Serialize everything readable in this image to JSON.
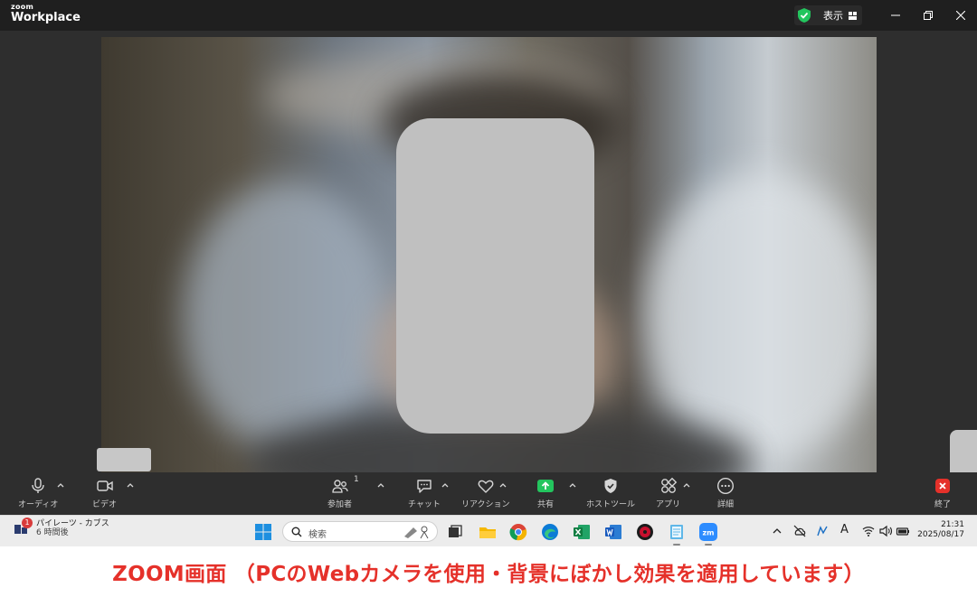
{
  "titlebar": {
    "logo_small": "zoom",
    "logo_big": "Workplace",
    "view_label": "表示"
  },
  "toolbar": {
    "audio_label": "オーディオ",
    "video_label": "ビデオ",
    "participants_label": "参加者",
    "participants_count": "1",
    "chat_label": "チャット",
    "reactions_label": "リアクション",
    "share_label": "共有",
    "host_tools_label": "ホストツール",
    "apps_label": "アプリ",
    "more_label": "詳細",
    "end_label": "終了"
  },
  "taskbar": {
    "news_title": "パイレーツ - カブス",
    "news_sub": "6 時間後",
    "news_badge": "1",
    "search_placeholder": "検索",
    "time": "21:31",
    "date": "2025/08/17"
  },
  "caption": {
    "text": "ZOOM画面 （PCのWebカメラを使用・背景にぼかし効果を適用しています）"
  },
  "colors": {
    "accent_green": "#23c55e",
    "end_red": "#e5312a",
    "caption_red": "#e5312a"
  }
}
